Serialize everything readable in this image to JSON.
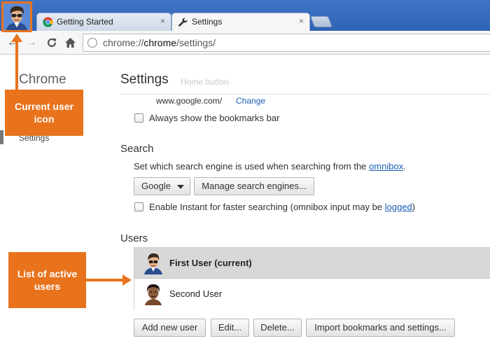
{
  "browser": {
    "tabs": [
      {
        "title": "Getting Started",
        "close": "×"
      },
      {
        "title": "Settings",
        "close": "×"
      }
    ],
    "nav": {
      "back": "←",
      "forward": "→",
      "reload": "C",
      "home": "⌂"
    },
    "url": {
      "prefix": "chrome://",
      "host": "chrome",
      "path": "/settings/"
    }
  },
  "sidebar": {
    "title": "Chrome",
    "items": [
      {
        "label": "Settings"
      }
    ]
  },
  "main": {
    "title": "Settings",
    "faded_text": "Home button",
    "home_page": {
      "url": "www.google.com/",
      "change_label": "Change"
    },
    "bookmarks_bar": {
      "label": "Always show the bookmarks bar",
      "checked": false
    },
    "search": {
      "title": "Search",
      "description": "Set which search engine is used when searching from the ",
      "description_link": "omnibox",
      "description_end": ".",
      "engine_selected": "Google",
      "manage_label": "Manage search engines...",
      "instant_label": "Enable Instant for faster searching (omnibox input may be ",
      "instant_link": "logged",
      "instant_end": ")",
      "instant_checked": false
    },
    "users": {
      "title": "Users",
      "list": [
        {
          "name": "First User (current)",
          "selected": true,
          "avatar": "hipster-glasses-avatar"
        },
        {
          "name": "Second User",
          "selected": false,
          "avatar": "curly-hair-avatar"
        }
      ],
      "buttons": {
        "add": "Add new user",
        "edit": "Edit...",
        "delete": "Delete...",
        "import": "Import bookmarks and settings..."
      }
    }
  },
  "annotations": {
    "current_user": "Current user icon",
    "active_users": "List of active users",
    "color": "#e8731c"
  }
}
